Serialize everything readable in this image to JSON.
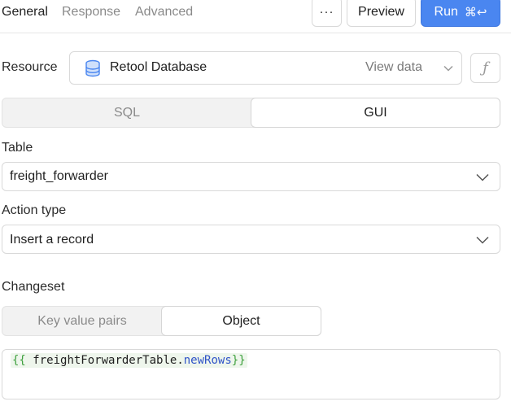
{
  "tabs": [
    {
      "label": "General",
      "active": true
    },
    {
      "label": "Response",
      "active": false
    },
    {
      "label": "Advanced",
      "active": false
    }
  ],
  "toolbar": {
    "more_label": "···",
    "preview_label": "Preview",
    "run_label": "Run",
    "run_shortcut": "⌘↩"
  },
  "resource": {
    "label": "Resource",
    "value": "Retool Database",
    "view_data_label": "View data",
    "icon": "database-icon",
    "function_icon": "ƒ"
  },
  "mode_toggle": {
    "options": [
      "SQL",
      "GUI"
    ],
    "selected": "GUI"
  },
  "table": {
    "label": "Table",
    "value": "freight_forwarder"
  },
  "action_type": {
    "label": "Action type",
    "value": "Insert a record"
  },
  "changeset": {
    "label": "Changeset",
    "options": [
      "Key value pairs",
      "Object"
    ],
    "selected": "Object",
    "code_open": "{{",
    "code_object": "freightForwarderTable",
    "code_dot": ".",
    "code_property": "newRows",
    "code_close": "}}"
  },
  "colors": {
    "run_button": "#4a86f0",
    "template_brace": "#3ea03e",
    "template_property": "#3054c8",
    "database_icon": "#4a86f0"
  }
}
